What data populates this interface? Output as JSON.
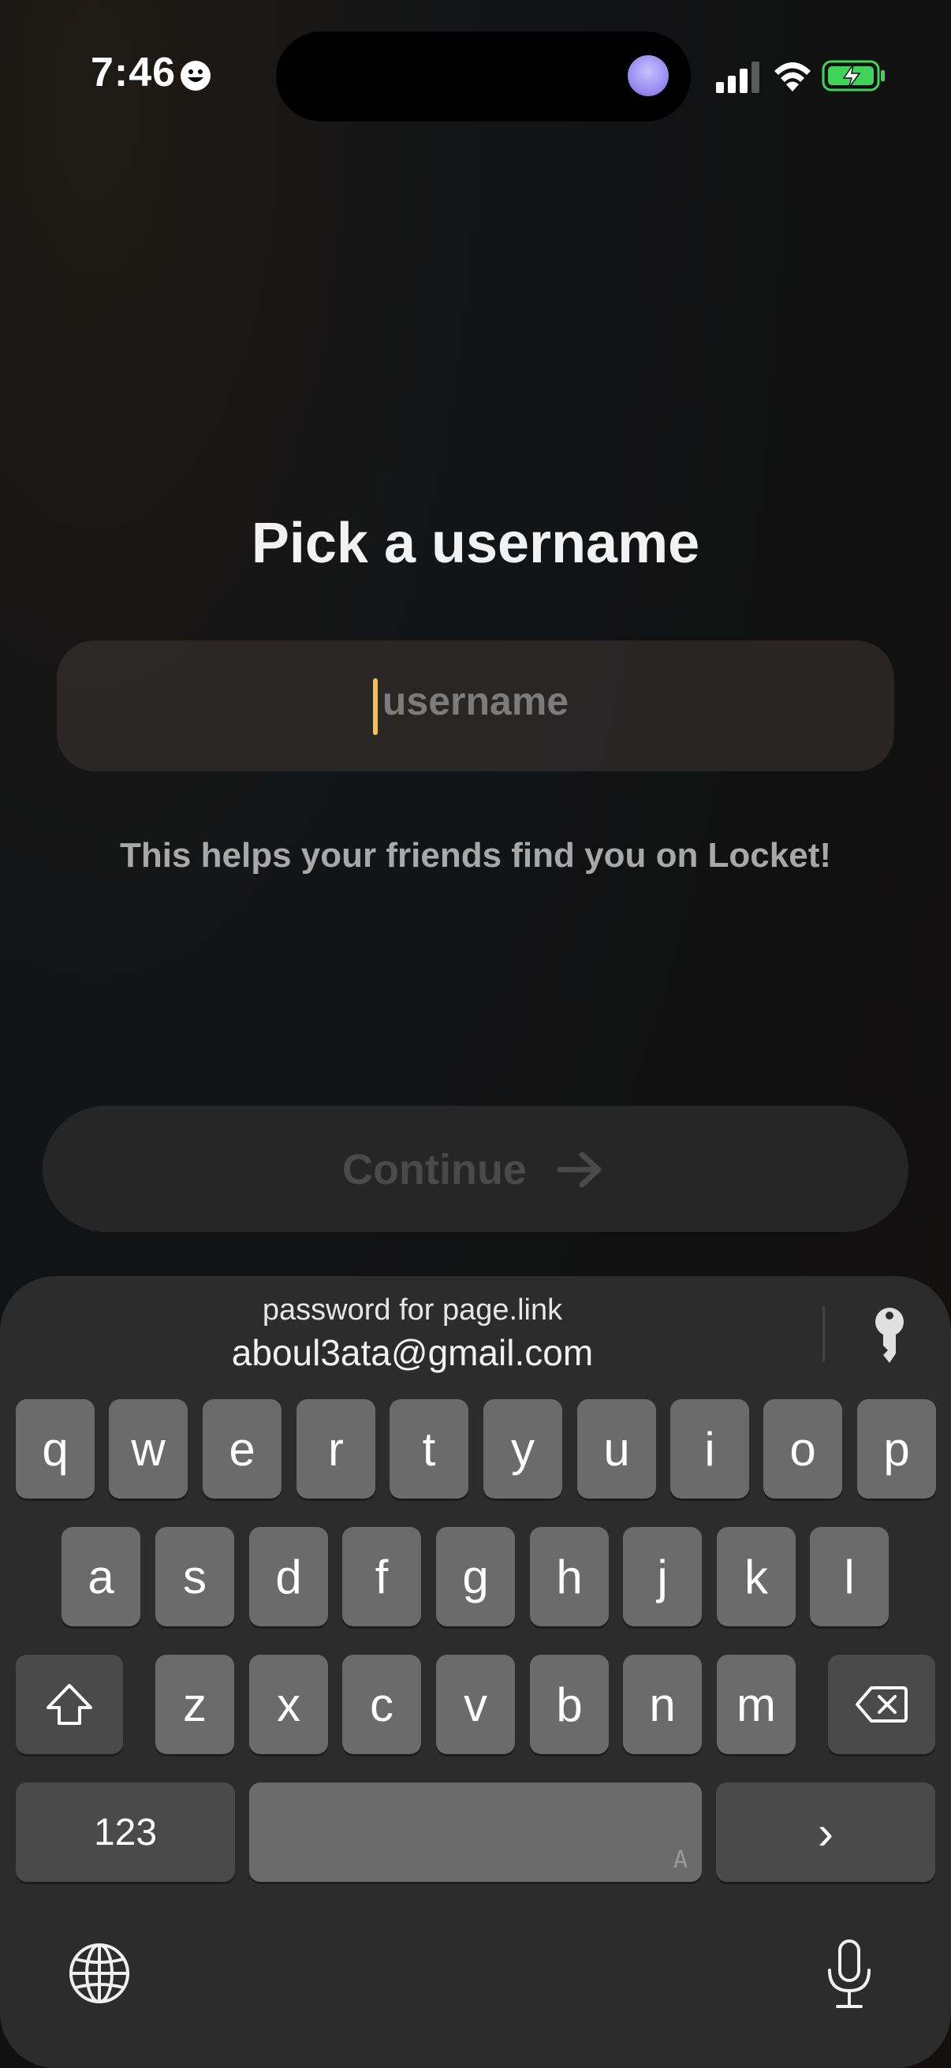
{
  "status_bar": {
    "time": "7:46",
    "icons": [
      "smiley-icon",
      "signal-icon",
      "wifi-icon",
      "battery-charging-icon"
    ]
  },
  "screen": {
    "title": "Pick a username",
    "input": {
      "value": "",
      "placeholder": "username"
    },
    "helper_text": "This helps your friends find you on Locket!",
    "continue_label": "Continue"
  },
  "keyboard": {
    "password_suggestion": {
      "top_line": "password for page.link",
      "account": "aboul3ata@gmail.com"
    },
    "rows": [
      [
        "q",
        "w",
        "e",
        "r",
        "t",
        "y",
        "u",
        "i",
        "o",
        "p"
      ],
      [
        "a",
        "s",
        "d",
        "f",
        "g",
        "h",
        "j",
        "k",
        "l"
      ],
      [
        "z",
        "x",
        "c",
        "v",
        "b",
        "n",
        "m"
      ]
    ],
    "numbers_key": "123",
    "space_corner": "A",
    "return_glyph": "›"
  },
  "colors": {
    "caret": "#f3c14e",
    "keyboard_bg": "#2c2c2c",
    "key_bg": "#6b6b6b"
  }
}
